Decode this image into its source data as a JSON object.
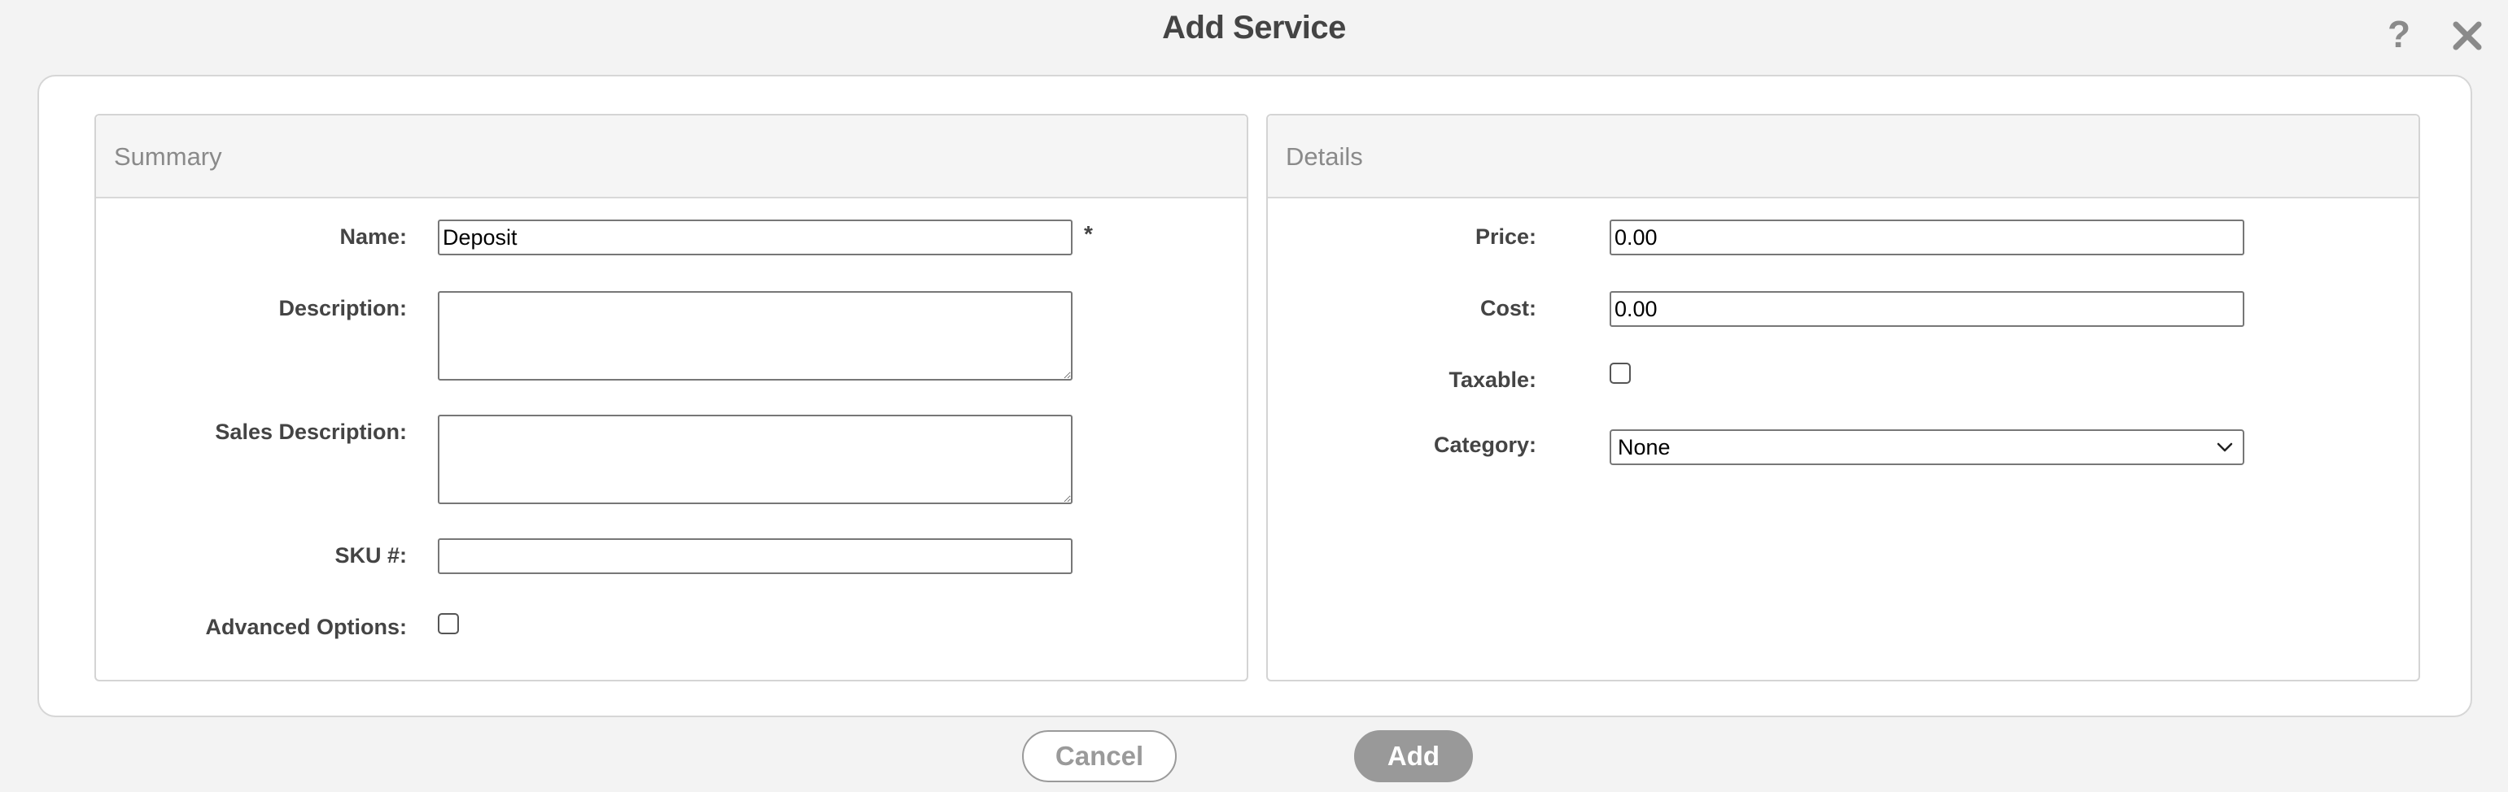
{
  "dialog": {
    "title": "Add Service",
    "help_glyph": "?"
  },
  "summary": {
    "header": "Summary",
    "name_label": "Name:",
    "name_value": "Deposit",
    "required_mark": "*",
    "description_label": "Description:",
    "description_value": "",
    "sales_description_label": "Sales Description:",
    "sales_description_value": "",
    "sku_label": "SKU #:",
    "sku_value": "",
    "advanced_options_label": "Advanced Options:"
  },
  "details": {
    "header": "Details",
    "price_label": "Price:",
    "price_value": "0.00",
    "cost_label": "Cost:",
    "cost_value": "0.00",
    "taxable_label": "Taxable:",
    "category_label": "Category:",
    "category_selected": "None"
  },
  "actions": {
    "cancel_label": "Cancel",
    "add_label": "Add"
  },
  "icons": {
    "help": "help-icon",
    "close": "close-icon",
    "dropdown": "chevron-down-icon"
  },
  "colors": {
    "background": "#f3f3f3",
    "card": "#ffffff",
    "panel_header": "#f5f5f5",
    "add_button": "#999999",
    "cancel_text": "#9a9a9a"
  }
}
